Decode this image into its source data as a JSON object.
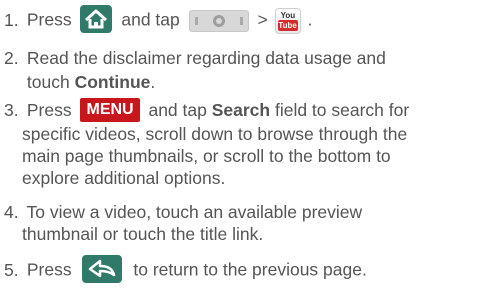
{
  "steps": [
    {
      "num": "1.",
      "a": "Press",
      "b": "and tap",
      "c": ">",
      "d": "."
    },
    {
      "num": "2.",
      "line1": "Read the disclaimer regarding data usage and",
      "line2_a": "touch ",
      "line2_bold": "Continue",
      "line2_b": "."
    },
    {
      "num": "3.",
      "a": "Press",
      "menu": "MENU",
      "b": "and tap ",
      "bold": "Search",
      "c": " field to search for",
      "line2": "specific videos, scroll down to browse through the",
      "line3": "main page thumbnails, or scroll to the bottom to",
      "line4": "explore additional options."
    },
    {
      "num": "4.",
      "line1": "To view a video, touch an available preview",
      "line2": "thumbnail or touch the title link."
    },
    {
      "num": "5.",
      "a": "Press",
      "b": "to return to the previous page."
    }
  ],
  "icons": {
    "home": "home-icon",
    "apps": "apps-icon",
    "youtube": "youtube-icon",
    "back": "back-icon"
  },
  "youtube_label": {
    "you": "You",
    "tube": "Tube"
  },
  "colors": {
    "text": "#555555",
    "green": "#2f7a68",
    "menu_red": "#c8171c"
  }
}
